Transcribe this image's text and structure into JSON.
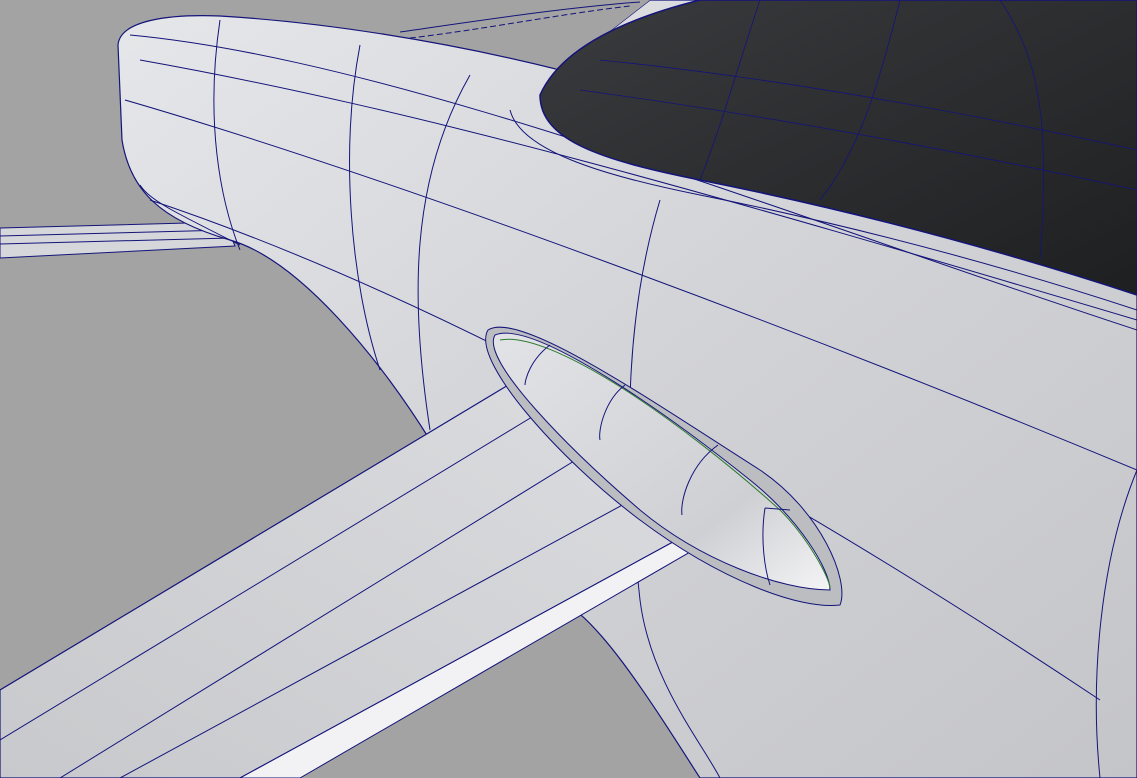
{
  "viewport": {
    "colors": {
      "background": "#a3a3a3",
      "surface": "#d4d5d9",
      "surface_highlight": "#eeeff2",
      "canopy": "#2b2c2e",
      "isocurve": "#14147a",
      "edge_highlight": "#2f7a2f"
    }
  }
}
